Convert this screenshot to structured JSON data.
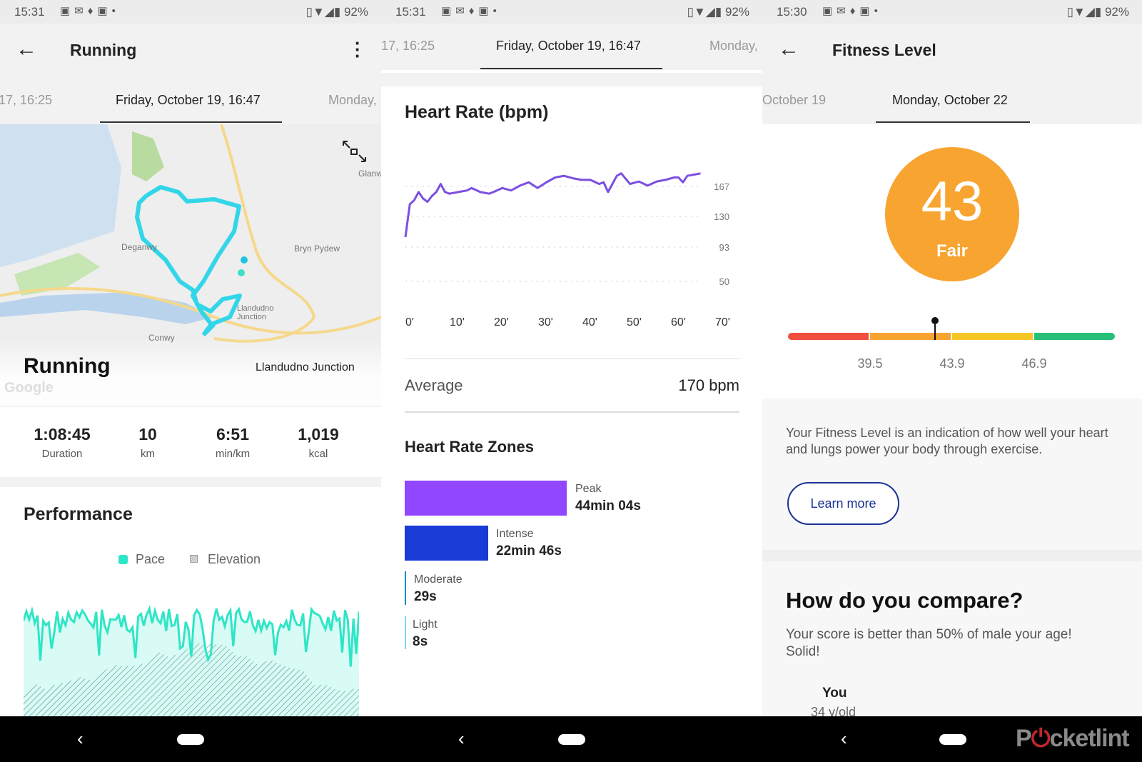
{
  "status_bars": [
    {
      "time": "15:31",
      "battery": "92%"
    },
    {
      "time": "15:31",
      "battery": "92%"
    },
    {
      "time": "15:30",
      "battery": "92%"
    }
  ],
  "running": {
    "title": "Running",
    "tabs": [
      "17, 16:25",
      "Friday, October 19, 16:47",
      "Monday,"
    ],
    "map": {
      "activity": "Running",
      "location": "Llandudno Junction",
      "labels": [
        "Deganwy",
        "Bryn Pydew",
        "Conwy",
        "Glanw",
        "Llandudno Junction",
        "Llandudno"
      ],
      "watermark": "Google"
    },
    "stats": [
      {
        "value": "1:08:45",
        "label": "Duration"
      },
      {
        "value": "10",
        "label": "km"
      },
      {
        "value": "6:51",
        "label": "min/km"
      },
      {
        "value": "1,019",
        "label": "kcal"
      }
    ],
    "performance": {
      "title": "Performance",
      "legend": [
        "Pace",
        "Elevation"
      ],
      "pace_color": "#2ee6c6"
    }
  },
  "heart": {
    "tabs": [
      "17, 16:25",
      "Friday, October 19, 16:47",
      "Monday,"
    ],
    "title": "Heart Rate (bpm)",
    "average_label": "Average",
    "average_value": "170 bpm",
    "zones_title": "Heart Rate Zones",
    "zones": [
      {
        "name": "Peak",
        "time": "44min 04s",
        "color": "#9146ff",
        "share": 0.66
      },
      {
        "name": "Intense",
        "time": "22min 46s",
        "color": "#1a3bd6",
        "share": 0.34
      },
      {
        "name": "Moderate",
        "time": "29s",
        "color": "#1b8ad6",
        "share": 0
      },
      {
        "name": "Light",
        "time": "8s",
        "color": "#7fd8ee",
        "share": 0
      }
    ]
  },
  "chart_data": {
    "type": "line",
    "title": "Heart Rate (bpm)",
    "x_ticks": [
      "0'",
      "10'",
      "20'",
      "30'",
      "40'",
      "50'",
      "60'",
      "70'"
    ],
    "y_ticks": [
      50,
      93,
      130,
      167
    ],
    "xlim": [
      0,
      70
    ],
    "grid": true,
    "line_color": "#7b4fe0",
    "x": [
      0,
      0.5,
      1,
      2,
      3,
      4,
      5,
      6,
      7,
      8,
      9,
      10,
      12,
      14,
      15,
      17,
      19,
      20,
      22,
      24,
      26,
      28,
      30,
      32,
      34,
      36,
      38,
      40,
      42,
      44,
      45,
      46,
      48,
      49,
      51,
      53,
      55,
      57,
      59,
      61,
      62,
      63,
      64,
      66,
      67
    ],
    "y": [
      105,
      125,
      145,
      150,
      160,
      152,
      148,
      155,
      160,
      170,
      160,
      158,
      160,
      162,
      165,
      160,
      158,
      160,
      165,
      162,
      168,
      172,
      165,
      172,
      178,
      180,
      177,
      175,
      175,
      170,
      172,
      160,
      180,
      183,
      170,
      173,
      168,
      173,
      175,
      178,
      178,
      172,
      180,
      182,
      183
    ]
  },
  "fitness": {
    "title": "Fitness Level",
    "tabs": [
      "October 19",
      "Monday, October 22"
    ],
    "score": "43",
    "rating": "Fair",
    "score_color": "#f8a431",
    "gauge_ticks": [
      "39.5",
      "43.9",
      "46.9"
    ],
    "gauge_colors": [
      "#f04e3e",
      "#f8a431",
      "#f5c626",
      "#27c07a"
    ],
    "gauge_value": 43,
    "description": "Your Fitness Level is an indication of how well your heart and lungs power your body through exercise.",
    "learn_more": "Learn more",
    "compare_title": "How do you compare?",
    "compare_text": "Your score is better than 50% of male your age! Solid!",
    "you_label": "You",
    "you_age": "34 y/old"
  },
  "watermark": "Pocket-lint"
}
